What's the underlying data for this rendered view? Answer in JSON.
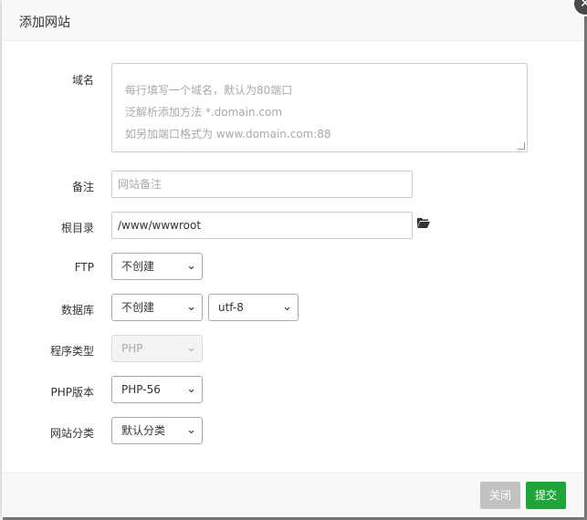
{
  "dialog": {
    "title": "添加网站",
    "close_glyph": "✕"
  },
  "form": {
    "domain": {
      "label": "域名",
      "placeholder_lines": [
        "每行填写一个域名，默认为80端口",
        "泛解析添加方法 *.domain.com",
        "如另加端口格式为 www.domain.com:88"
      ]
    },
    "remark": {
      "label": "备注",
      "placeholder": "网站备注",
      "value": ""
    },
    "root": {
      "label": "根目录",
      "value": "/www/wwwroot",
      "icon": "folder-open-icon"
    },
    "ftp": {
      "label": "FTP",
      "selected": "不创建"
    },
    "database": {
      "label": "数据库",
      "selected": "不创建",
      "charset": "utf-8"
    },
    "program": {
      "label": "程序类型",
      "selected": "PHP",
      "disabled": true
    },
    "php": {
      "label": "PHP版本",
      "selected": "PHP-56"
    },
    "category": {
      "label": "网站分类",
      "selected": "默认分类"
    }
  },
  "footer": {
    "close_label": "关闭",
    "submit_label": "提交"
  },
  "colors": {
    "submit": "#20a53a",
    "close": "#c2c2c2",
    "header_bg": "#f8f8f8"
  }
}
